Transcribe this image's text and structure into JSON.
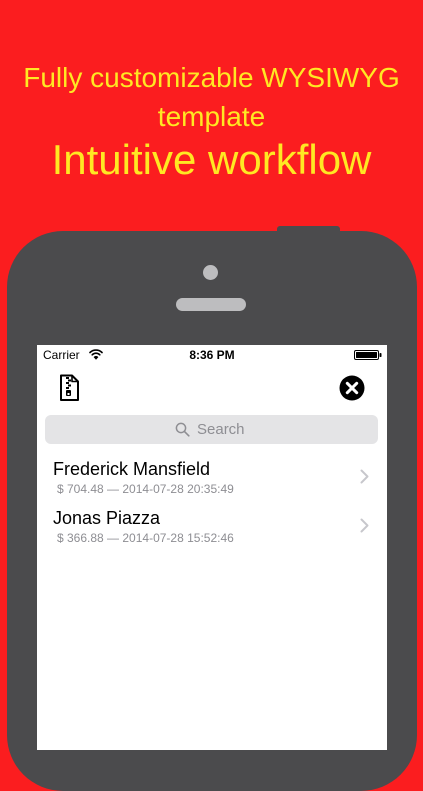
{
  "promo": {
    "line1": "Fully customizable WYSIWYG",
    "line2": "template",
    "headline": "Intuitive workflow"
  },
  "status_bar": {
    "carrier": "Carrier",
    "time": "8:36 PM"
  },
  "toolbar": {
    "left_icon": "zip-file-icon",
    "right_icon": "close-icon"
  },
  "search": {
    "placeholder": "Search"
  },
  "items": [
    {
      "name": "Frederick Mansfield",
      "detail": "$ 704.48  —  2014-07-28 20:35:49"
    },
    {
      "name": "Jonas Piazza",
      "detail": "$ 366.88  —  2014-07-28 15:52:46"
    }
  ],
  "colors": {
    "background": "#fb1d1f",
    "promo_text": "#ffe823",
    "phone_body": "#4b4b4d",
    "search_field": "#e4e4e6",
    "secondary_text": "#8e8e93"
  }
}
